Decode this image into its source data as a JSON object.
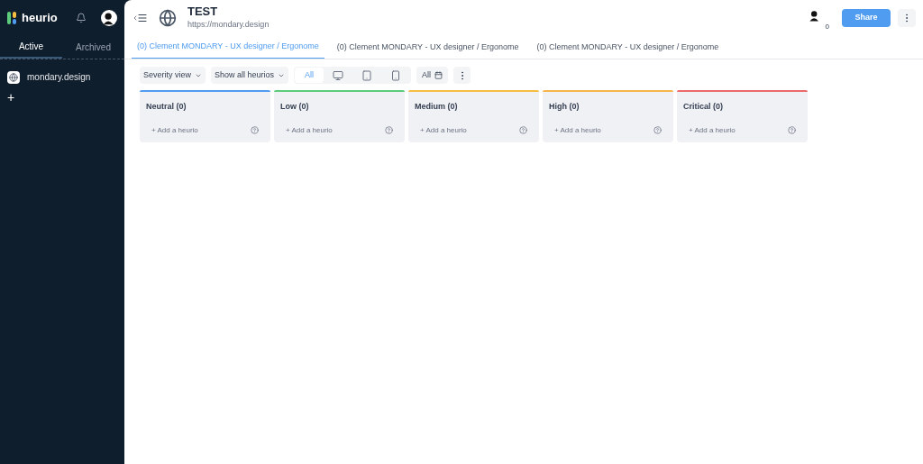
{
  "sidebar": {
    "logo": "heurio",
    "tabs": [
      {
        "label": "Active",
        "selected": true
      },
      {
        "label": "Archived",
        "selected": false
      }
    ],
    "projects": [
      {
        "name": "mondary.design"
      }
    ],
    "add": "+"
  },
  "header": {
    "title": "TEST",
    "url": "https://mondary.design",
    "avatar_badge": "0",
    "share": "Share"
  },
  "tabs": [
    {
      "label": "(0) Clement MONDARY - UX designer / Ergonome",
      "selected": true
    },
    {
      "label": "(0) Clement MONDARY - UX designer / Ergonome",
      "selected": false
    },
    {
      "label": "(0) Clement MONDARY - UX designer / Ergonome",
      "selected": false
    }
  ],
  "toolbar": {
    "view": "Severity view",
    "filter": "Show all heurios",
    "devices": [
      {
        "kind": "all",
        "label": "All",
        "selected": true
      },
      {
        "kind": "desktop",
        "selected": false
      },
      {
        "kind": "tablet",
        "selected": false
      },
      {
        "kind": "phone",
        "selected": false
      }
    ],
    "date": "All"
  },
  "columns": [
    {
      "title": "Neutral (0)",
      "color": "#4f9cf0",
      "add": "+ Add a heurio"
    },
    {
      "title": "Low (0)",
      "color": "#5ccb7c",
      "add": "+ Add a heurio"
    },
    {
      "title": "Medium (0)",
      "color": "#f5bd41",
      "add": "+ Add a heurio"
    },
    {
      "title": "High (0)",
      "color": "#f5b54a",
      "add": "+ Add a heurio"
    },
    {
      "title": "Critical (0)",
      "color": "#ec6a6a",
      "add": "+ Add a heurio"
    }
  ]
}
